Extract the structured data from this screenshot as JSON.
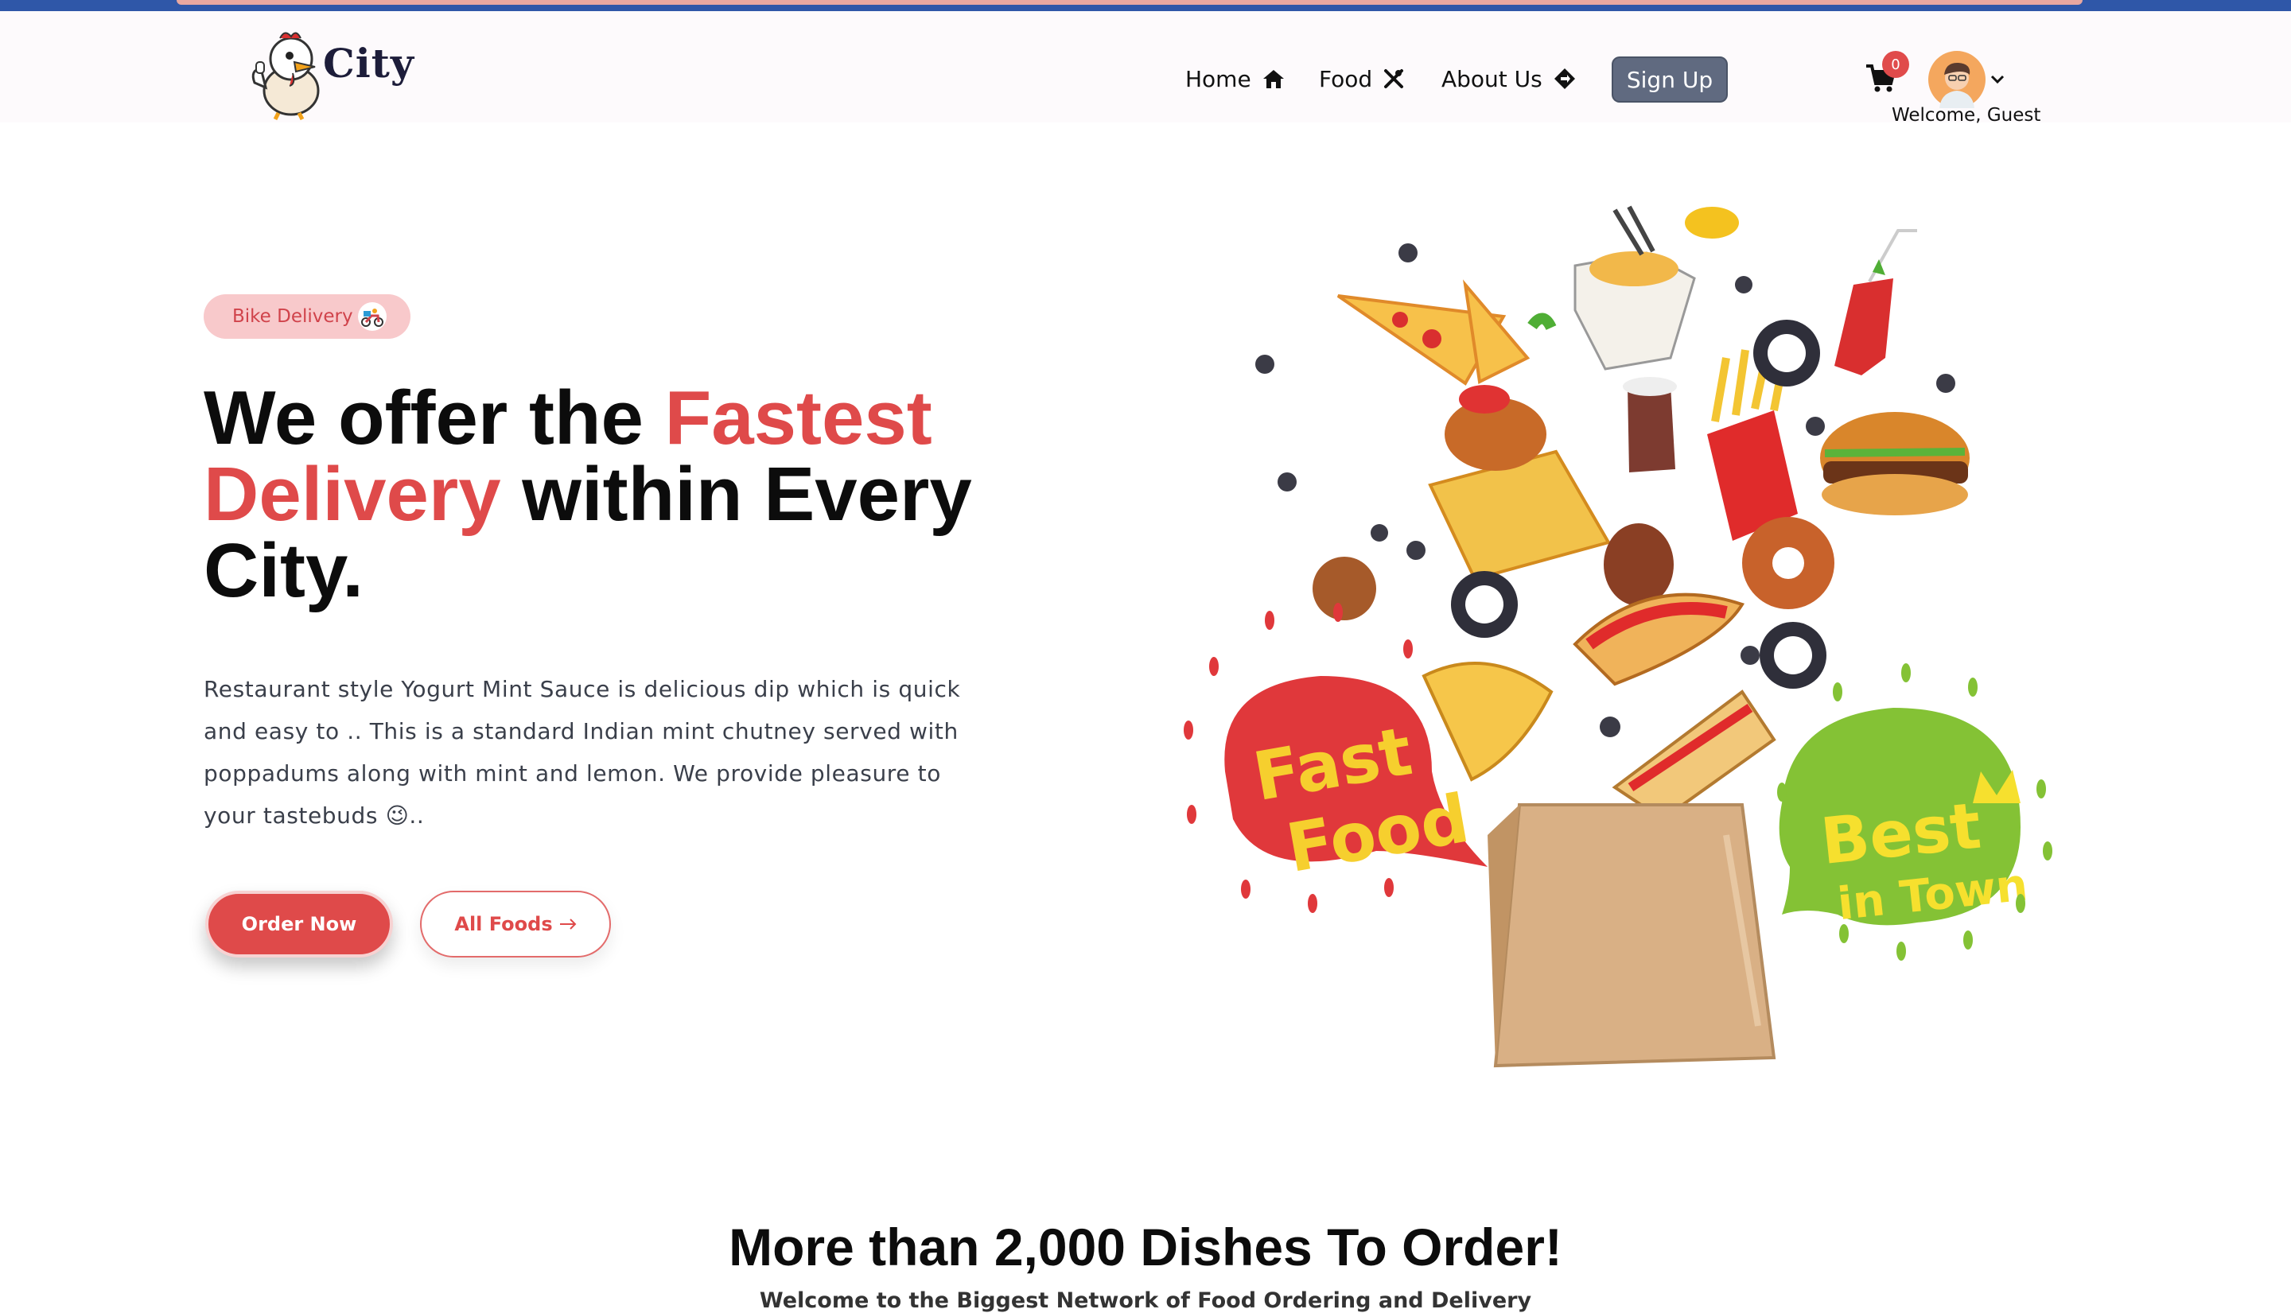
{
  "brand": {
    "name": "City"
  },
  "nav": {
    "items": [
      {
        "label": "Home",
        "icon": "home-icon"
      },
      {
        "label": "Food",
        "icon": "utensils-icon"
      },
      {
        "label": "About Us",
        "icon": "diamond-arrow-icon"
      }
    ],
    "signup_label": "Sign Up",
    "cart_count": "0",
    "welcome": "Welcome, Guest"
  },
  "hero": {
    "badge": "Bike Delivery",
    "headline": {
      "part1": "We offer the ",
      "accent1": "Fastest",
      "accent2": "Delivery",
      "part2": " within Every City."
    },
    "description": "Restaurant style Yogurt Mint Sauce is delicious dip which is quick and easy to .. This is a standard Indian mint chutney served with poppadums along with mint and lemon. We provide pleasure to your tastebuds 😉..",
    "order_button": "Order Now",
    "all_foods_button": "All Foods",
    "illustration": {
      "fast_food_text": [
        "Fast",
        "Food"
      ],
      "best_text": [
        "Best",
        "in Town"
      ]
    }
  },
  "section": {
    "title": "More than 2,000 Dishes To Order!",
    "subtitle": "Welcome to the Biggest Network of Food Ordering and Delivery"
  },
  "colors": {
    "accent": "#df4a4a",
    "top_strip": "#2f57a8",
    "signup_bg": "#606a80",
    "badge_bg": "#f8c9cb"
  }
}
